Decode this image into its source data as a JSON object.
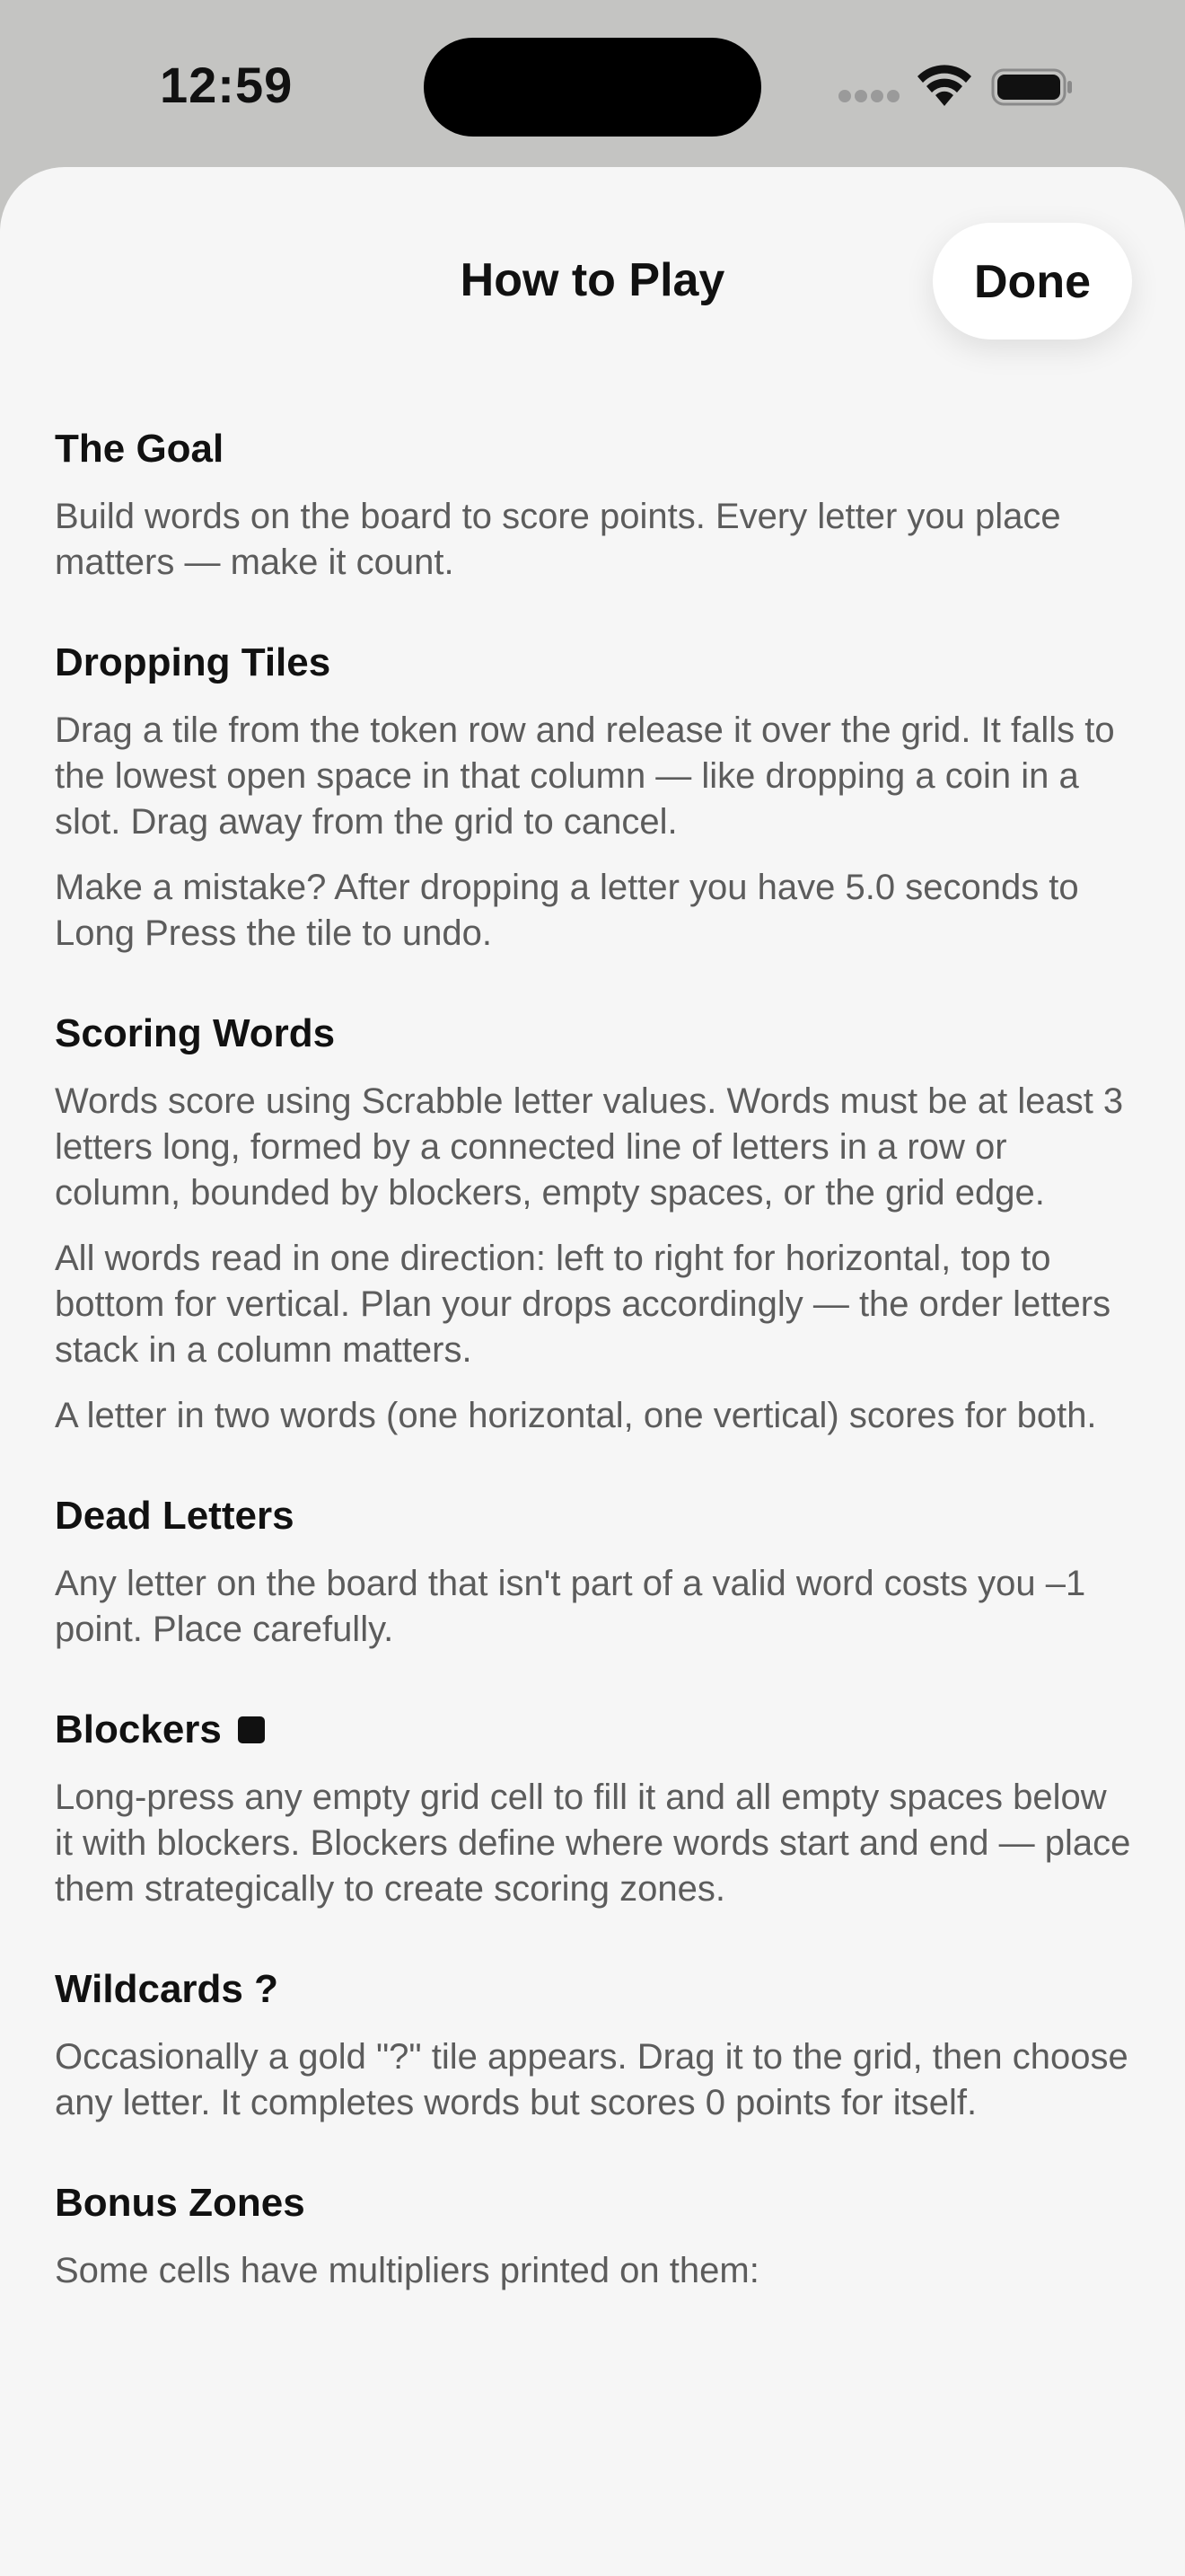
{
  "status": {
    "time": "12:59"
  },
  "sheet": {
    "title": "How to Play",
    "done_label": "Done"
  },
  "sections": [
    {
      "heading": "The Goal",
      "paragraphs": [
        "Build words on the board to score points. Every letter you place matters — make it count."
      ]
    },
    {
      "heading": "Dropping Tiles",
      "paragraphs": [
        "Drag a tile from the token row and release it over the grid. It falls to the lowest open space in that column — like dropping a coin in a slot. Drag away from the grid to cancel.",
        "Make a mistake? After dropping a letter you have 5.0 seconds to Long Press the tile to undo."
      ]
    },
    {
      "heading": "Scoring Words",
      "paragraphs": [
        "Words score using Scrabble letter values. Words must be at least 3 letters long, formed by a connected line of letters in a row or column, bounded by blockers, empty spaces, or the grid edge.",
        "All words read in one direction: left to right for horizontal, top to bottom for vertical. Plan your drops accordingly — the order letters stack in a column matters.",
        "A letter in two words (one horizontal, one vertical) scores for both."
      ]
    },
    {
      "heading": "Dead Letters",
      "paragraphs": [
        "Any letter on the board that isn't part of a valid word costs you –1 point. Place carefully."
      ]
    },
    {
      "heading": "Blockers",
      "paragraphs": [
        "Long-press any empty grid cell to fill it and all empty spaces below it with blockers. Blockers define where words start and end — place them strategically to create scoring zones."
      ]
    },
    {
      "heading": "Wildcards ?",
      "paragraphs": [
        "Occasionally a gold \"?\" tile appears. Drag it to the grid, then choose any letter. It completes words but scores 0 points for itself."
      ]
    },
    {
      "heading": "Bonus Zones",
      "paragraphs": [
        "Some cells have multipliers printed on them:"
      ]
    }
  ]
}
